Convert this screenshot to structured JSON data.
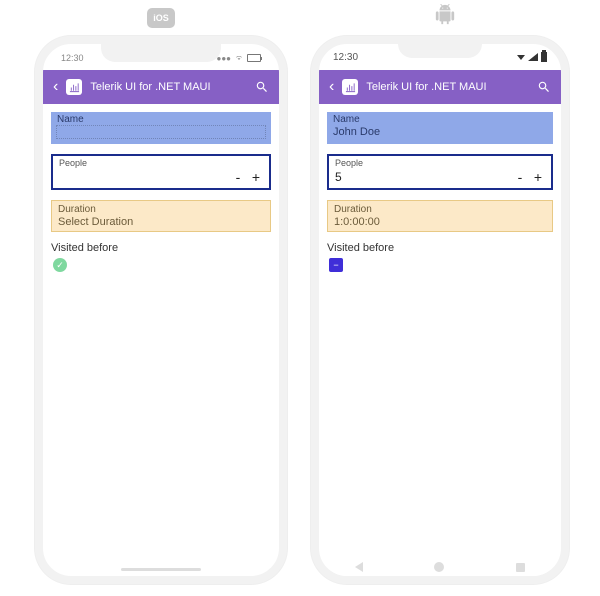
{
  "platform_badges": {
    "ios": "iOS",
    "android": "Android"
  },
  "ios": {
    "status": {
      "time": "12:30"
    },
    "header": {
      "title": "Telerik UI for .NET MAUI"
    },
    "name": {
      "label": "Name",
      "value": ""
    },
    "people": {
      "label": "People",
      "value": "",
      "minus": "-",
      "plus": "+"
    },
    "duration": {
      "label": "Duration",
      "value": "Select Duration"
    },
    "visited": {
      "label": "Visited before"
    }
  },
  "android": {
    "status": {
      "time": "12:30"
    },
    "header": {
      "title": "Telerik UI for .NET MAUI"
    },
    "name": {
      "label": "Name",
      "value": "John Doe"
    },
    "people": {
      "label": "People",
      "value": "5",
      "minus": "-",
      "plus": "+"
    },
    "duration": {
      "label": "Duration",
      "value": "1:0:00:00"
    },
    "visited": {
      "label": "Visited before"
    }
  }
}
